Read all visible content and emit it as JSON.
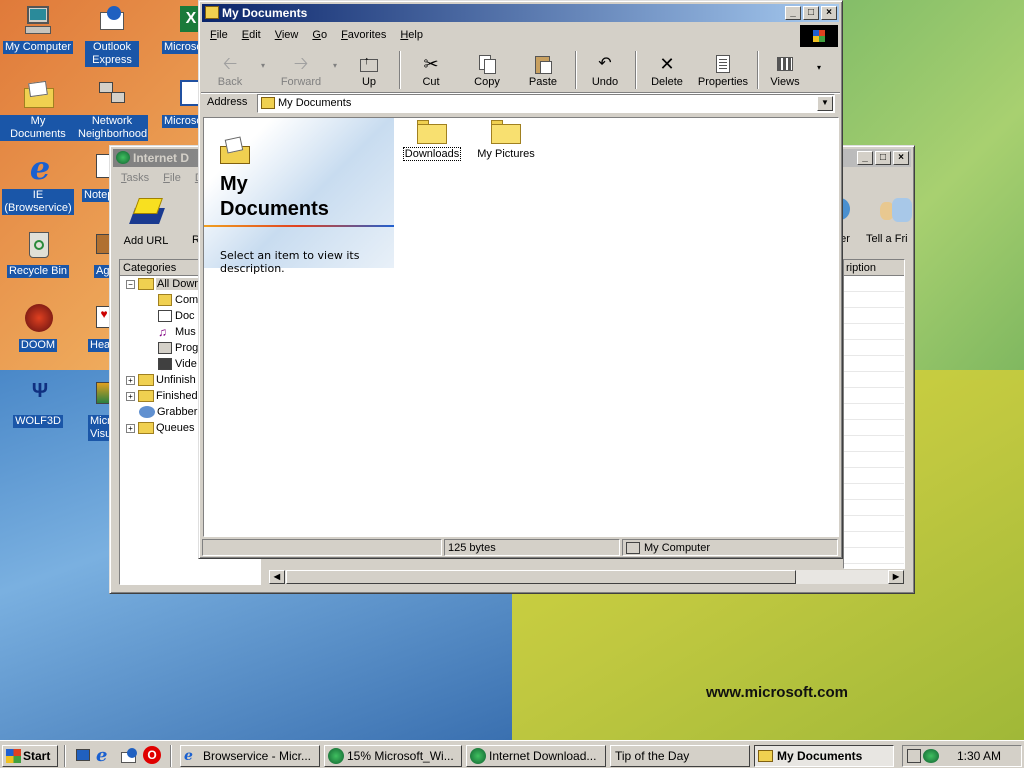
{
  "desktop": {
    "watermark": "www.microsoft.com",
    "icons": [
      {
        "label": "My Computer",
        "icon": "my-computer-icon"
      },
      {
        "label": "Outlook Express",
        "icon": "outlook-express-icon"
      },
      {
        "label": "Microsoft Excel",
        "icon": "excel-icon"
      },
      {
        "label": "My Documents",
        "icon": "my-documents-icon"
      },
      {
        "label": "Network Neighborhood",
        "icon": "network-neighborhood-icon"
      },
      {
        "label": "Microsoft FrontPage",
        "icon": "frontpage-icon"
      },
      {
        "label": "IE (Browservice)",
        "icon": "internet-explorer-icon"
      },
      {
        "label": "Notepad",
        "icon": "notepad-icon"
      },
      {
        "label": "Recycle Bin",
        "icon": "recycle-bin-icon"
      },
      {
        "label": "Age of Empires",
        "icon": "age-of-empires-icon"
      },
      {
        "label": "DOOM",
        "icon": "doom-icon"
      },
      {
        "label": "Hearts",
        "icon": "hearts-icon"
      },
      {
        "label": "WOLF3D",
        "icon": "wolf3d-icon"
      },
      {
        "label": "Microsoft Visual",
        "icon": "visual-studio-icon"
      }
    ]
  },
  "idm": {
    "title": "Internet D",
    "menu": [
      "Tasks",
      "File",
      "Do"
    ],
    "tools": {
      "add_url": "Add URL",
      "partial_r": "R",
      "partial_er": "er",
      "tell_friend": "Tell a Fri"
    },
    "categories_header": "Categories",
    "desc_header": "ription",
    "tree": [
      "All Down",
      "Com",
      "Doc",
      "Mus",
      "Prog",
      "Vide",
      "Unfinish",
      "Finished",
      "Grabber",
      "Queues"
    ]
  },
  "explorer": {
    "title": "My Documents",
    "menu": [
      "File",
      "Edit",
      "View",
      "Go",
      "Favorites",
      "Help"
    ],
    "toolbar": {
      "back": "Back",
      "forward": "Forward",
      "up": "Up",
      "cut": "Cut",
      "copy": "Copy",
      "paste": "Paste",
      "undo": "Undo",
      "delete": "Delete",
      "properties": "Properties",
      "views": "Views"
    },
    "address_label": "Address",
    "address_value": "My Documents",
    "panel_title_line1": "My",
    "panel_title_line2": "Documents",
    "panel_desc": "Select an item to view its description.",
    "files": [
      {
        "name": "Downloads"
      },
      {
        "name": "My Pictures"
      }
    ],
    "status_size": "125 bytes",
    "status_location": "My Computer"
  },
  "taskbar": {
    "start": "Start",
    "tasks": [
      {
        "label": "Browservice - Micr..."
      },
      {
        "label": "15% Microsoft_Wi..."
      },
      {
        "label": "Internet Download..."
      },
      {
        "label": "Tip of the Day"
      },
      {
        "label": "My Documents"
      }
    ],
    "clock": "1:30 AM"
  }
}
